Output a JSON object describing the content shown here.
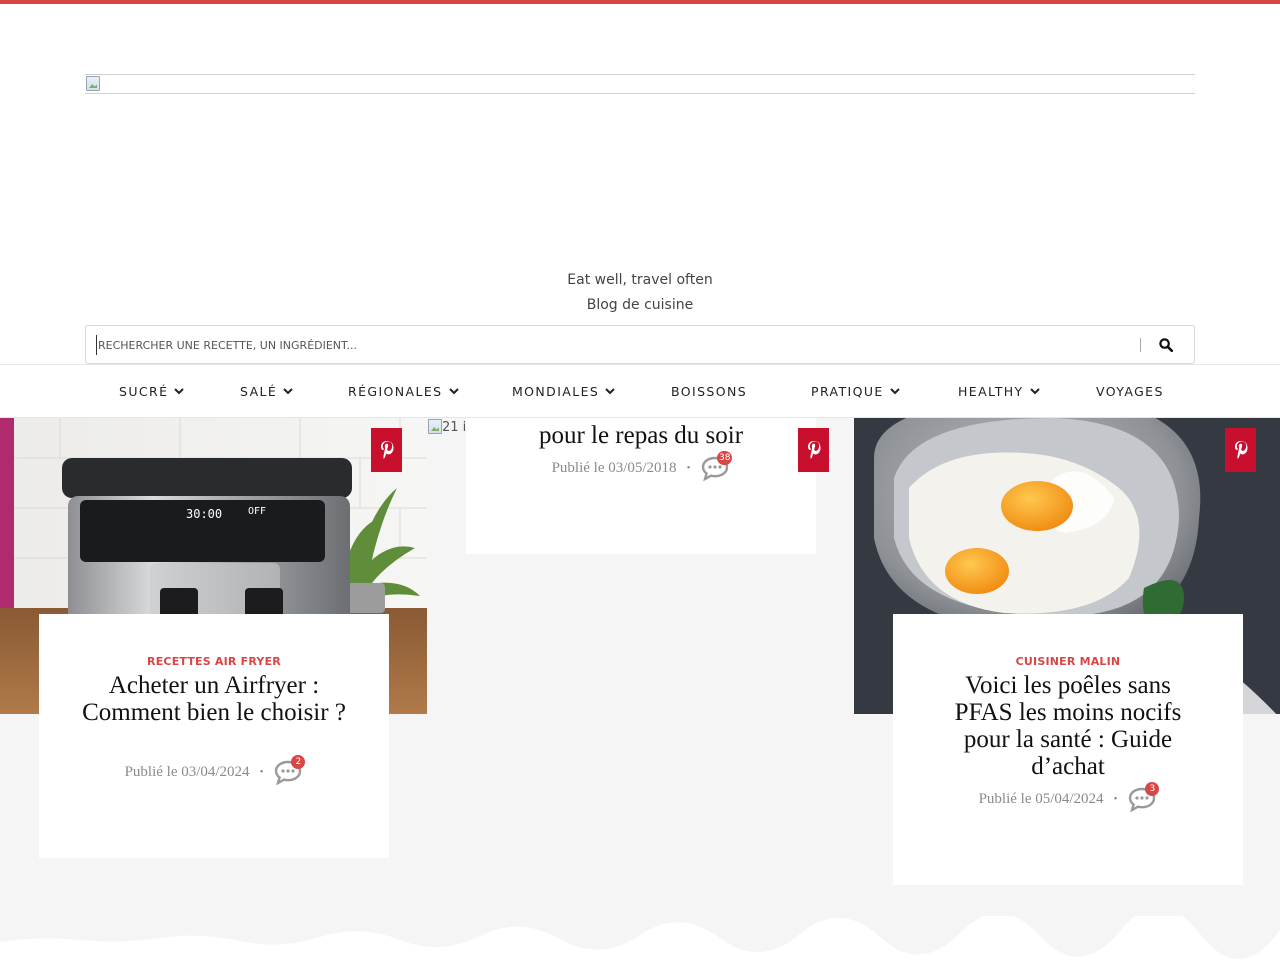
{
  "header": {
    "tagline": "Eat well, travel often",
    "subtitle": "Blog de cuisine",
    "search": {
      "placeholder": "RECHERCHER UNE RECETTE, UN INGRÉDIENT..."
    }
  },
  "nav": {
    "items": [
      {
        "label": "SUCRÉ",
        "has_dropdown": true
      },
      {
        "label": "SALÉ",
        "has_dropdown": true
      },
      {
        "label": "RÉGIONALES",
        "has_dropdown": true
      },
      {
        "label": "MONDIALES",
        "has_dropdown": true
      },
      {
        "label": "BOISSONS",
        "has_dropdown": false
      },
      {
        "label": "PRATIQUE",
        "has_dropdown": true
      },
      {
        "label": "HEALTHY",
        "has_dropdown": true
      },
      {
        "label": "VOYAGES",
        "has_dropdown": false
      }
    ]
  },
  "posts": [
    {
      "category": "RECETTES AIR FRYER",
      "title": "Acheter un Airfryer : Comment bien le choisir ?",
      "date": "Publié le 03/04/2024",
      "comments": "2"
    },
    {
      "image_alt": "21 i",
      "title": "pour le repas du soir",
      "date": "Publié le 03/05/2018",
      "comments": "38"
    },
    {
      "category": "CUISINER MALIN",
      "title": "Voici les poêles sans PFAS les moins nocifs pour la santé : Guide d’achat",
      "date": "Publié le 05/04/2024",
      "comments": "3"
    }
  ],
  "colors": {
    "accent": "#d94646",
    "pinterest": "#c8102e",
    "band": "#f5f5f5"
  },
  "icons": [
    "search-icon",
    "chevron-down-icon",
    "pinterest-icon",
    "comment-icon",
    "broken-image-icon"
  ]
}
